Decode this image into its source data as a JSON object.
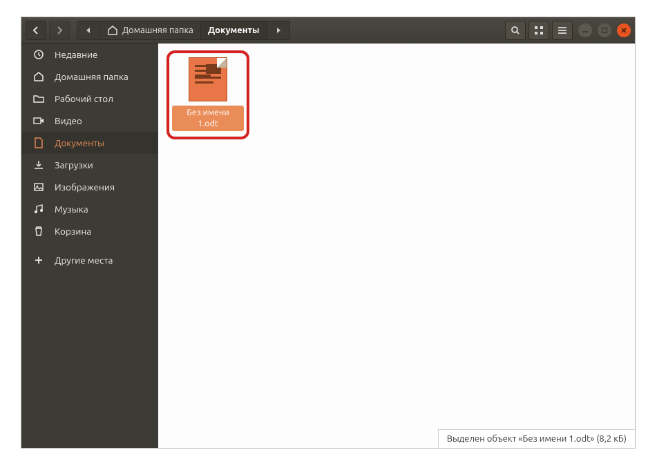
{
  "titlebar": {
    "path": [
      {
        "label": "Домашняя папка",
        "active": false,
        "hasHomeIcon": true
      },
      {
        "label": "Документы",
        "active": true,
        "hasHomeIcon": false
      }
    ]
  },
  "sidebar": {
    "items": [
      {
        "id": "recent",
        "label": "Недавние",
        "icon": "clock-icon"
      },
      {
        "id": "home",
        "label": "Домашняя папка",
        "icon": "home-icon"
      },
      {
        "id": "desktop",
        "label": "Рабочий стол",
        "icon": "folder-icon"
      },
      {
        "id": "videos",
        "label": "Видео",
        "icon": "video-icon"
      },
      {
        "id": "documents",
        "label": "Документы",
        "icon": "document-icon",
        "active": true
      },
      {
        "id": "downloads",
        "label": "Загрузки",
        "icon": "download-icon"
      },
      {
        "id": "pictures",
        "label": "Изображения",
        "icon": "picture-icon"
      },
      {
        "id": "music",
        "label": "Музыка",
        "icon": "music-icon"
      },
      {
        "id": "trash",
        "label": "Корзина",
        "icon": "trash-icon"
      },
      {
        "id": "other",
        "label": "Другие места",
        "icon": "plus-icon"
      }
    ]
  },
  "main": {
    "selected_file": {
      "name": "Без имени 1.odt"
    }
  },
  "statusbar": {
    "text": "Выделен объект «Без имени 1.odt»  (8,2 кБ)"
  }
}
